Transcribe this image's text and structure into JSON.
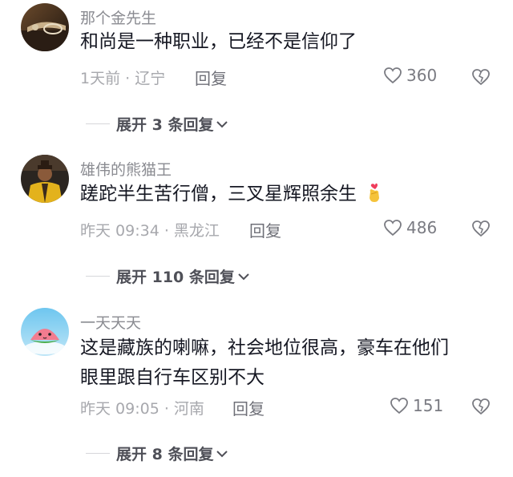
{
  "comments": [
    {
      "username": "那个金先生",
      "text": "和尚是一种职业，已经不是信仰了",
      "meta": "1天前 · 辽宁",
      "reply_label": "回复",
      "likes": "360",
      "expand_label": "展开 3 条回复",
      "avatar_icon": "car-steering-avatar"
    },
    {
      "username": "雄伟的熊猫王",
      "text": "蹉跎半生苦行僧，三叉星辉照余生",
      "emoji": "finger-heart-emoji",
      "meta": "昨天 09:34 · 黑龙江",
      "reply_label": "回复",
      "likes": "486",
      "expand_label": "展开 110 条回复",
      "avatar_icon": "person-yellow-suit-avatar"
    },
    {
      "username": "一天天天",
      "text_line1": "这是藏族的喇嘛，社会地位很高，豪车在他们",
      "text_line2": "眼里跟自行车区别不大",
      "meta": "昨天 09:05 · 河南",
      "reply_label": "回复",
      "likes": "151",
      "expand_label": "展开 8 条回复",
      "avatar_icon": "watermelon-avatar"
    }
  ],
  "colors": {
    "text": "#161823",
    "username": "#8a8b91",
    "meta": "#a7a8ad",
    "expand": "#4f5058"
  }
}
